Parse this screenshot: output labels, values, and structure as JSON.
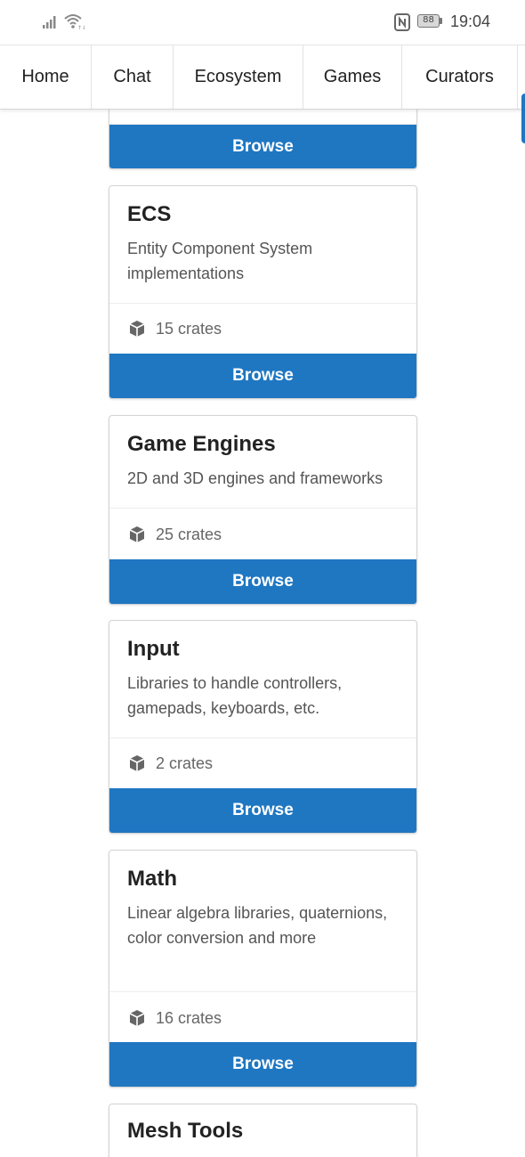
{
  "status": {
    "time": "19:04",
    "battery": "88"
  },
  "nav": {
    "items": [
      {
        "label": "Home"
      },
      {
        "label": "Chat"
      },
      {
        "label": "Ecosystem"
      },
      {
        "label": "Games"
      },
      {
        "label": "Curators"
      }
    ]
  },
  "browse_label": "Browse",
  "cards": [
    {
      "title": "ECS",
      "description": "Entity Component System implementations",
      "crates": "15 crates"
    },
    {
      "title": "Game Engines",
      "description": "2D and 3D engines and frameworks",
      "crates": "25 crates"
    },
    {
      "title": "Input",
      "description": "Libraries to handle controllers, gamepads, keyboards, etc.",
      "crates": "2 crates"
    },
    {
      "title": "Math",
      "description": "Linear algebra libraries, quaternions, color conversion and more",
      "crates": "16 crates"
    },
    {
      "title": "Mesh Tools",
      "description": "",
      "crates": ""
    }
  ],
  "icons": {
    "crate": "cube-icon"
  },
  "colors": {
    "accent": "#1f77c2"
  }
}
